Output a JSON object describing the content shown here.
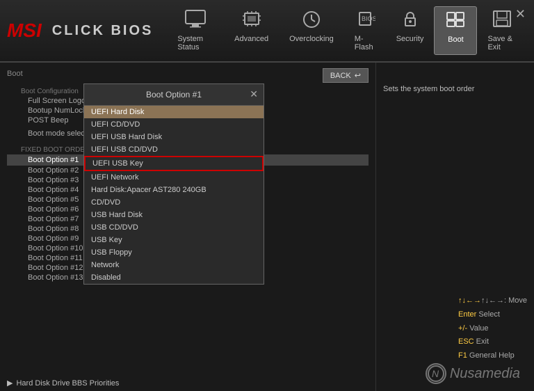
{
  "app": {
    "title": "MSI",
    "subtitle": "CLICK BIOS",
    "close_label": "✕"
  },
  "nav": {
    "tabs": [
      {
        "id": "system-status",
        "label": "System Status",
        "icon": "monitor",
        "active": false
      },
      {
        "id": "advanced",
        "label": "Advanced",
        "icon": "cpu",
        "active": false
      },
      {
        "id": "overclocking",
        "label": "Overclocking",
        "icon": "clock",
        "active": false
      },
      {
        "id": "m-flash",
        "label": "M-Flash",
        "icon": "chip",
        "active": false
      },
      {
        "id": "security",
        "label": "Security",
        "icon": "lock",
        "active": false
      },
      {
        "id": "boot",
        "label": "Boot",
        "icon": "boot",
        "active": true
      },
      {
        "id": "save-exit",
        "label": "Save & Exit",
        "icon": "save",
        "active": false
      }
    ]
  },
  "main": {
    "breadcrumb": "Boot",
    "back_label": "BACK",
    "help_text": "Sets the system boot order",
    "boot_sections": [
      {
        "type": "label",
        "text": "Boot Configuration"
      },
      {
        "type": "item",
        "text": "Full Screen Logo Display"
      },
      {
        "type": "item",
        "text": "Bootup NumLock State"
      },
      {
        "type": "item",
        "text": "POST Beep"
      },
      {
        "type": "spacer"
      },
      {
        "type": "item",
        "text": "Boot mode select"
      },
      {
        "type": "spacer"
      },
      {
        "type": "label",
        "text": "FIXED BOOT ORDER Priorities"
      },
      {
        "type": "item",
        "text": "Boot Option #1",
        "selected": true
      },
      {
        "type": "item",
        "text": "Boot Option #2"
      },
      {
        "type": "item",
        "text": "Boot Option #3"
      },
      {
        "type": "item",
        "text": "Boot Option #4"
      },
      {
        "type": "item",
        "text": "Boot Option #5"
      },
      {
        "type": "item",
        "text": "Boot Option #6"
      },
      {
        "type": "item",
        "text": "Boot Option #7"
      },
      {
        "type": "item",
        "text": "Boot Option #8"
      },
      {
        "type": "item",
        "text": "Boot Option #9"
      },
      {
        "type": "item",
        "text": "Boot Option #10"
      },
      {
        "type": "item",
        "text": "Boot Option #11"
      },
      {
        "type": "item",
        "text": "Boot Option #12"
      },
      {
        "type": "item",
        "text": "Boot Option #13"
      }
    ],
    "bottom_item": {
      "icon": "arrow",
      "text": "Hard Disk Drive BBS Priorities"
    }
  },
  "modal": {
    "title": "Boot Option #1",
    "close_label": "✕",
    "options": [
      {
        "text": "UEFI Hard Disk",
        "highlighted": true
      },
      {
        "text": "UEFI CD/DVD"
      },
      {
        "text": "UEFI USB Hard Disk"
      },
      {
        "text": "UEFI USB CD/DVD"
      },
      {
        "text": "UEFI USB Key",
        "selected_red": true
      },
      {
        "text": "UEFI Network"
      },
      {
        "text": "Hard Disk:Apacer AST280 240GB"
      },
      {
        "text": "CD/DVD"
      },
      {
        "text": "USB Hard Disk"
      },
      {
        "text": "USB CD/DVD"
      },
      {
        "text": "USB Key"
      },
      {
        "text": "USB Floppy"
      },
      {
        "text": "Network"
      },
      {
        "text": "Disabled"
      }
    ]
  },
  "key_help": {
    "move": "↑↓←→: Move",
    "select": "Enter: Select",
    "value": "+/-: Value",
    "exit": "ESC: Exit",
    "general_help": "F1: General Help"
  },
  "watermark": {
    "icon": "N",
    "text": "Nusamedia"
  }
}
